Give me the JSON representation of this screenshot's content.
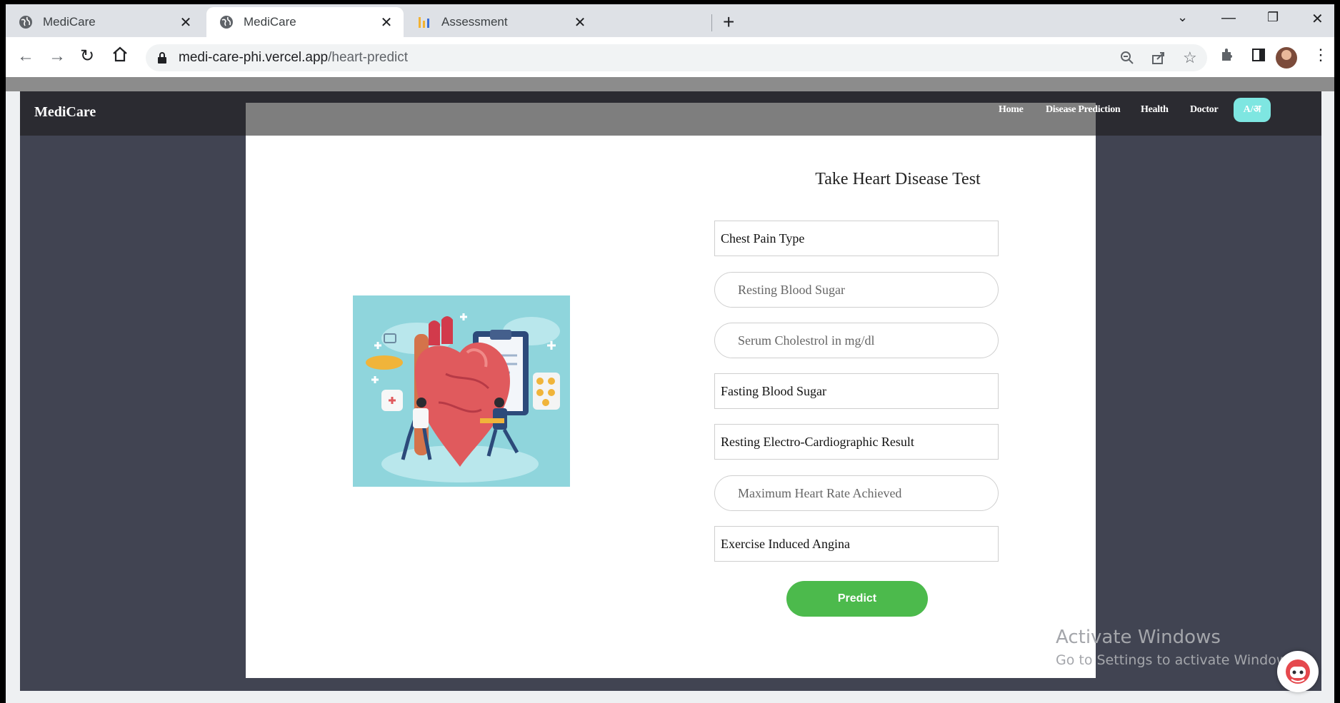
{
  "browser": {
    "tabs": [
      {
        "title": "MediCare",
        "active": false
      },
      {
        "title": "MediCare",
        "active": true
      },
      {
        "title": "Assessment",
        "active": false
      }
    ],
    "address": {
      "host": "medi-care-phi.vercel.app",
      "path": "/heart-predict"
    }
  },
  "site": {
    "brand": "MediCare",
    "nav": {
      "home": "Home",
      "disease_prediction": "Disease Prediction",
      "health": "Health",
      "doctor": "Doctor",
      "language": "A/अ"
    }
  },
  "form": {
    "title": "Take Heart Disease Test",
    "fields": [
      {
        "placeholder": "Chest Pain Type",
        "style": "square"
      },
      {
        "placeholder": "Resting Blood Sugar",
        "style": "round"
      },
      {
        "placeholder": "Serum Cholestrol in mg/dl",
        "style": "round"
      },
      {
        "placeholder": "Fasting Blood Sugar",
        "style": "square"
      },
      {
        "placeholder": "Resting Electro-Cardiographic Result",
        "style": "square"
      },
      {
        "placeholder": "Maximum Heart Rate Achieved",
        "style": "round"
      },
      {
        "placeholder": "Exercise Induced Angina",
        "style": "square"
      }
    ],
    "submit_label": "Predict",
    "accent": "#4cba4c"
  },
  "watermark": {
    "line1": "Activate Windows",
    "line2": "Go to Settings to activate Windows."
  },
  "colors": {
    "nav_bg": "#2b2b31",
    "page_bg": "#414452",
    "lang_button": "#7ee6e1",
    "illustration_bg": "#8fd5dc"
  }
}
